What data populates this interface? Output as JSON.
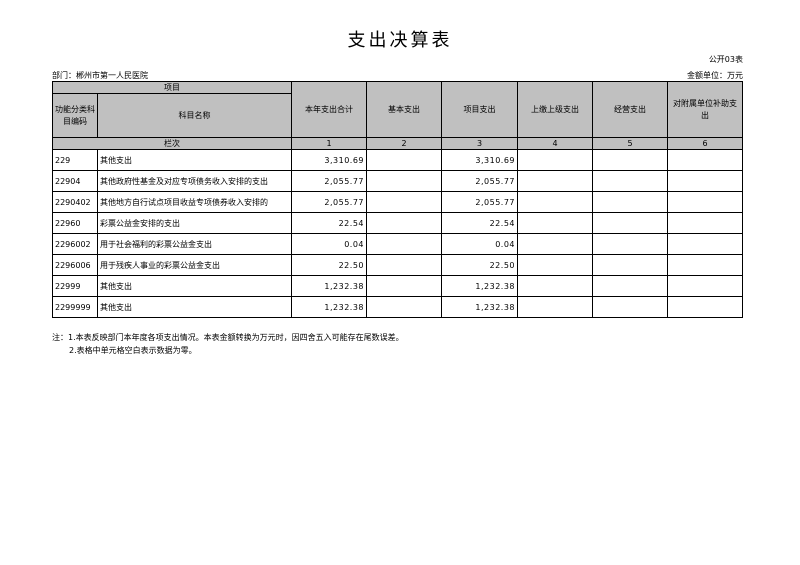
{
  "title": "支出决算表",
  "form_no": "公开03表",
  "department": "部门：郴州市第一人民医院",
  "unit": "金额单位：万元",
  "header": {
    "item": "项目",
    "func_code": "功能分类科目编码",
    "subject_name": "科目名称",
    "col_total": "本年支出合计",
    "col_basic": "基本支出",
    "col_project": "项目支出",
    "col_upper": "上缴上级支出",
    "col_business": "经营支出",
    "col_subsidy": "对附属单位补助支出",
    "row_index_label": "栏次",
    "idx": [
      "1",
      "2",
      "3",
      "4",
      "5",
      "6"
    ]
  },
  "rows": [
    {
      "code": "229",
      "name": "其他支出",
      "total": "3,310.69",
      "basic": "",
      "project": "3,310.69",
      "upper": "",
      "business": "",
      "subsidy": ""
    },
    {
      "code": "22904",
      "name": "其他政府性基金及对应专项债务收入安排的支出",
      "total": "2,055.77",
      "basic": "",
      "project": "2,055.77",
      "upper": "",
      "business": "",
      "subsidy": ""
    },
    {
      "code": "2290402",
      "name": "其他地方自行试点项目收益专项债券收入安排的",
      "total": "2,055.77",
      "basic": "",
      "project": "2,055.77",
      "upper": "",
      "business": "",
      "subsidy": ""
    },
    {
      "code": "22960",
      "name": "彩票公益金安排的支出",
      "total": "22.54",
      "basic": "",
      "project": "22.54",
      "upper": "",
      "business": "",
      "subsidy": ""
    },
    {
      "code": "2296002",
      "name": "用于社会福利的彩票公益金支出",
      "total": "0.04",
      "basic": "",
      "project": "0.04",
      "upper": "",
      "business": "",
      "subsidy": ""
    },
    {
      "code": "2296006",
      "name": "用于残疾人事业的彩票公益金支出",
      "total": "22.50",
      "basic": "",
      "project": "22.50",
      "upper": "",
      "business": "",
      "subsidy": ""
    },
    {
      "code": "22999",
      "name": "其他支出",
      "total": "1,232.38",
      "basic": "",
      "project": "1,232.38",
      "upper": "",
      "business": "",
      "subsidy": ""
    },
    {
      "code": "2299999",
      "name": "其他支出",
      "total": "1,232.38",
      "basic": "",
      "project": "1,232.38",
      "upper": "",
      "business": "",
      "subsidy": ""
    }
  ],
  "notes": [
    "注：1.本表反映部门本年度各项支出情况。本表金额转换为万元时，因四舍五入可能存在尾数误差。",
    "2.表格中单元格空白表示数据为零。"
  ]
}
